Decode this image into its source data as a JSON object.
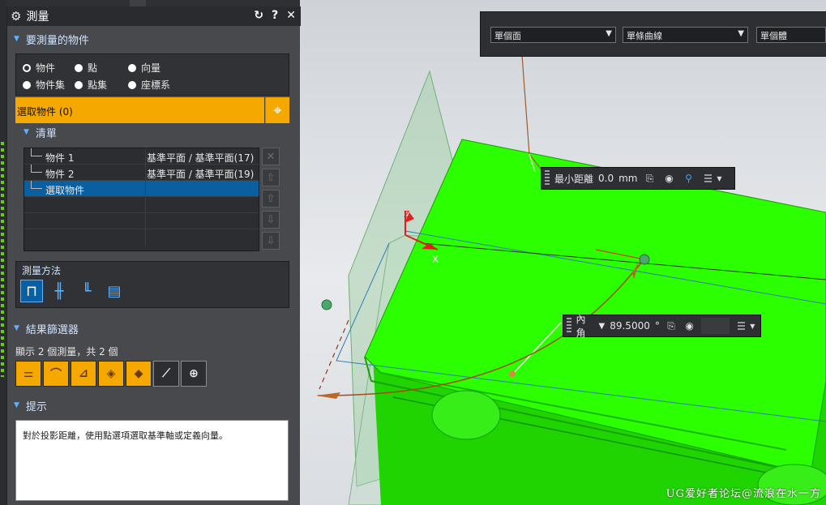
{
  "dialog": {
    "title": "測量",
    "sections": {
      "object_to_measure": "要測量的物件",
      "list": "清單",
      "method": "測量方法",
      "result_filter": "結果篩選器",
      "hint": "提示"
    },
    "radio_options": [
      {
        "label": "物件",
        "selected": true
      },
      {
        "label": "點",
        "selected": false
      },
      {
        "label": "向量",
        "selected": false
      },
      {
        "label": "物件集",
        "selected": false
      },
      {
        "label": "點集",
        "selected": false
      },
      {
        "label": "座標系",
        "selected": false
      }
    ],
    "select_row_label": "選取物件 (0)",
    "list_rows": [
      {
        "name": "物件 1",
        "type": "基準平面 / 基準平面(17)"
      },
      {
        "name": "物件 2",
        "type": "基準平面 / 基準平面(19)"
      },
      {
        "name": "選取物件",
        "type": ""
      }
    ],
    "result_count": "顯示 2 個測量，共 2 個",
    "hint_text": "對於投影距離，使用點選項選取基準軸或定義向量。"
  },
  "selection_filters": {
    "face_rule": "單個面",
    "curve_rule": "單條曲線",
    "body_rule": "單個體"
  },
  "readouts": {
    "min_distance": {
      "label": "最小距離",
      "value": "0.0",
      "unit": "mm"
    },
    "angle": {
      "label": "內角",
      "value": "89.5000",
      "unit": "°"
    }
  },
  "axis_labels": {
    "z": "Z",
    "x": "X"
  },
  "watermark": "UG爱好者论坛@流浪在水一方",
  "colors": {
    "accent": "#f5a800",
    "selection_blue": "#0a5fa0",
    "model_green": "#22ff00",
    "panel_bg": "#48494d"
  }
}
